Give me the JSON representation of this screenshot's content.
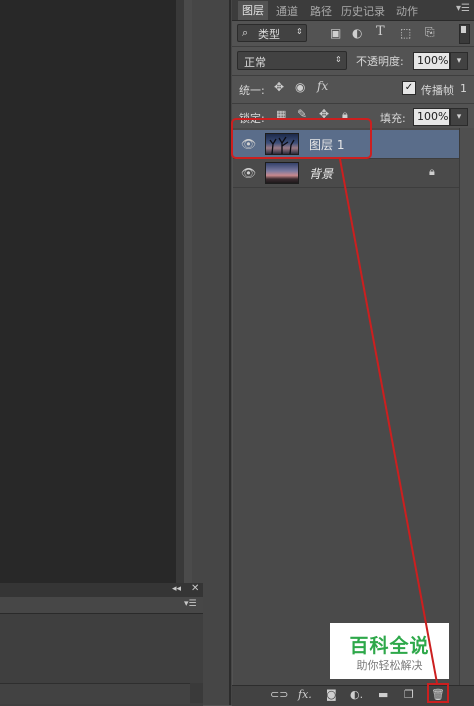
{
  "tabs": [
    {
      "label": "图层"
    },
    {
      "label": "通道"
    },
    {
      "label": "路径"
    },
    {
      "label": "历史记录"
    },
    {
      "label": "动作"
    }
  ],
  "filter": {
    "label": "类型"
  },
  "blend_mode": {
    "value": "正常"
  },
  "opacity": {
    "label": "不透明度:",
    "value": "100%"
  },
  "unify": {
    "label": "统一:"
  },
  "propagate": {
    "label": "传播帧",
    "value": "1"
  },
  "lock": {
    "label": "锁定:"
  },
  "fill": {
    "label": "填充:",
    "value": "100%"
  },
  "layers": [
    {
      "name": "图层 1",
      "selected": true
    },
    {
      "name": "背景",
      "locked": true
    }
  ],
  "watermark": {
    "title": "百科全说",
    "subtitle": "助你轻松解决"
  },
  "colors": {
    "selected_row": "#5a6d8a",
    "annotation": "#cc1f1f",
    "watermark_green": "#2ea84a"
  }
}
